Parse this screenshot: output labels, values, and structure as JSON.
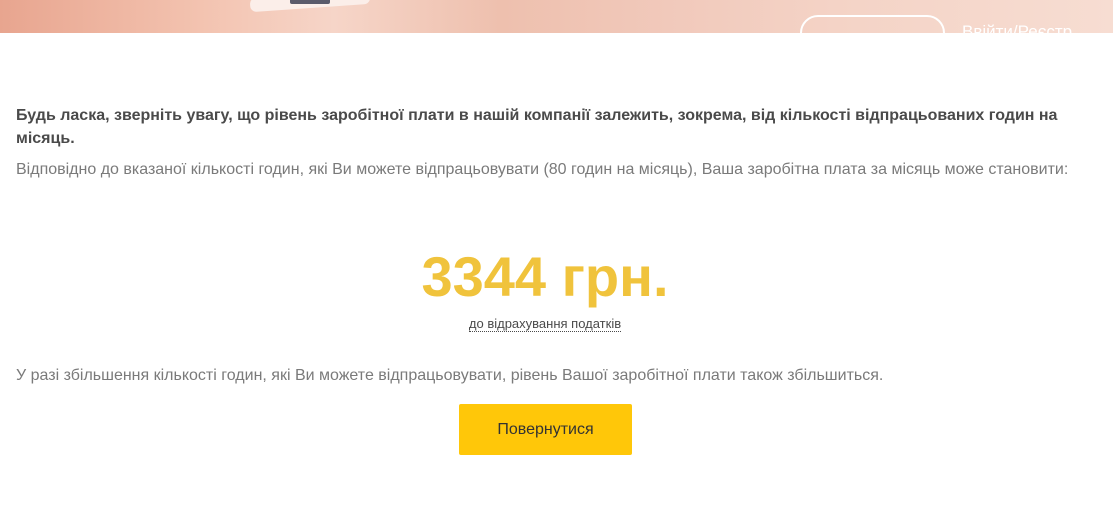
{
  "header": {
    "nav_link": "Ввійти/Реєстр."
  },
  "notice": "Будь ласка, зверніть увагу, що рівень заробітної плати в нашій компанії залежить, зокрема, від кількості відпрацьованих годин на місяць.",
  "description": "Відповідно до вказаної кількості годин, які Ви можете відпрацьовувати (80 годин на місяць), Ваша заробітна плата за місяць може становити:",
  "salary": {
    "amount": "3344 грн.",
    "note": "до відрахування податків"
  },
  "increase_note": "У разі збільшення кількості годин, які Ви можете відпрацьовувати, рівень Вашої заробітної плати також збільшиться.",
  "back_button": "Повернутися",
  "colors": {
    "accent": "#ffc709",
    "amount": "#f0c33c"
  }
}
